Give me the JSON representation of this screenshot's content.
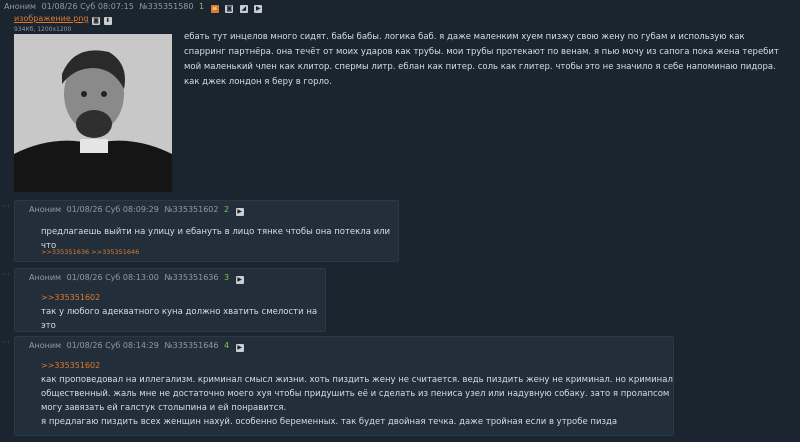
{
  "op": {
    "author": "Аноним",
    "datetime": "01/08/26 Суб 08:07:15",
    "number": "№335351580",
    "count": "1",
    "file_name": "изображение.png",
    "file_info": "934Кб, 1200x1200",
    "text": "ебать тут инцелов много сидят. бабы бабы. логика баб. я даже маленким хуем пизжу свою жену по губам и использую как спарринг партнёра. она течёт от моих ударов как трубы. мои трубы протекают по венам. я пью мочу из сапога пока жена теребит мой маленький член как клитор. спермы литр. еблан как питер. соль как глитер. чтобы это не значило я себе напоминаю пидора. как джек лондон я беру в горло."
  },
  "posts": [
    {
      "author": "Аноним",
      "datetime": "01/08/26 Суб 08:09:29",
      "number": "№335351602",
      "count": "2",
      "text": "предлагаешь выйти на улицу и ебануть в лицо тянке чтобы она потекла или что",
      "replies": ">>335351636 >>335351646"
    },
    {
      "author": "Аноним",
      "datetime": "01/08/26 Суб 08:13:00",
      "number": "№335351636",
      "count": "3",
      "reply_to": ">>335351602",
      "text": "так у любого адекватного куна должно хватить смелости на это"
    },
    {
      "author": "Аноним",
      "datetime": "01/08/26 Суб 08:14:29",
      "number": "№335351646",
      "count": "4",
      "reply_to": ">>335351602",
      "lines": [
        "как проповедовал на иллегализм. криминал смысл жизни. хоть пиздить жену не считается. ведь пиздить жену не криминал. но криминал",
        "общественный. жаль мне не достаточно моего хуя чтобы придушить её и сделать из пениса узел или надувную собаку. зато я пролапсом",
        "могу завязать ей галстук столыпина и ей понравится.",
        "я предлагаю пиздить всех женщин нахуй. особенно беременных. так будет двойная течка. даже тройная если в утробе пизда"
      ]
    }
  ],
  "colors": {
    "background": "#1b2530",
    "post": "#222e3a",
    "accent": "#e07a2a",
    "count": "#8fbf5a"
  },
  "icons": [
    "menu-icon",
    "image-search-icon",
    "expand-icon",
    "play-icon"
  ]
}
